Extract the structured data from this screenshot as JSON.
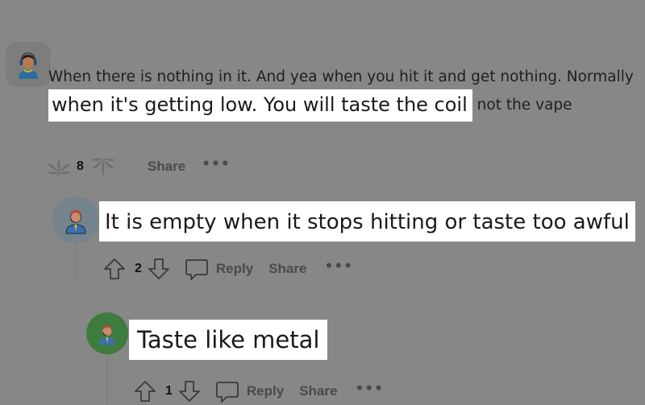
{
  "comments": [
    {
      "avatar": "headset-person-avatar-icon",
      "text_before": "When there is nothing in it. And yea when you hit it and get nothing. Normally ",
      "text_highlight": "when it's getting low. You will taste the coil",
      "text_after": " not the vape",
      "votes": "8",
      "upvote_icon": "leaf-upvote-icon",
      "downvote_icon": "leaf-downvote-icon",
      "share_label": "Share",
      "more_label": "•••"
    },
    {
      "avatar": "support-agent-avatar-icon",
      "text_highlight": "It is empty when it stops hitting or taste too awful",
      "votes": "2",
      "reply_label": "Reply",
      "share_label": "Share",
      "more_label": "•••"
    },
    {
      "avatar": "support-agent-avatar-icon",
      "text_highlight": "Taste like metal",
      "votes": "1",
      "reply_label": "Reply",
      "share_label": "Share",
      "more_label": "•••"
    }
  ],
  "colors": {
    "overlay_background": "#878787",
    "highlight_background": "#ffffff",
    "avatar_2_bg": "#75838c",
    "avatar_3_bg": "#3e7b3e"
  }
}
